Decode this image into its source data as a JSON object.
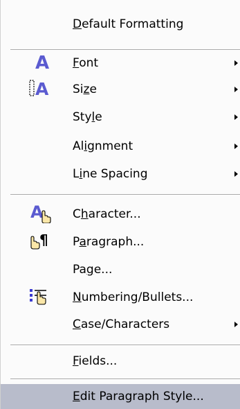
{
  "menu": {
    "items": [
      {
        "pre": "",
        "ul": "D",
        "post": "efault Formatting"
      },
      {
        "pre": "",
        "ul": "F",
        "post": "ont"
      },
      {
        "pre": "Si",
        "ul": "z",
        "post": "e"
      },
      {
        "pre": "Sty",
        "ul": "l",
        "post": "e"
      },
      {
        "pre": "Al",
        "ul": "i",
        "post": "gnment"
      },
      {
        "pre": "L",
        "ul": "i",
        "post": "ne Spacing"
      },
      {
        "pre": "C",
        "ul": "h",
        "post": "aracter..."
      },
      {
        "pre": "P",
        "ul": "a",
        "post": "ragraph..."
      },
      {
        "pre": "Pa",
        "ul": "g",
        "post": "e..."
      },
      {
        "pre": "",
        "ul": "N",
        "post": "umbering/Bullets..."
      },
      {
        "pre": "",
        "ul": "C",
        "post": "ase/Characters"
      },
      {
        "pre": "",
        "ul": "F",
        "post": "ields..."
      },
      {
        "pre": "",
        "ul": "E",
        "post": "dit Paragraph Style..."
      }
    ]
  },
  "colors": {
    "icon_purple": "#5b5bd0",
    "hover_bg": "#b8bccb"
  }
}
